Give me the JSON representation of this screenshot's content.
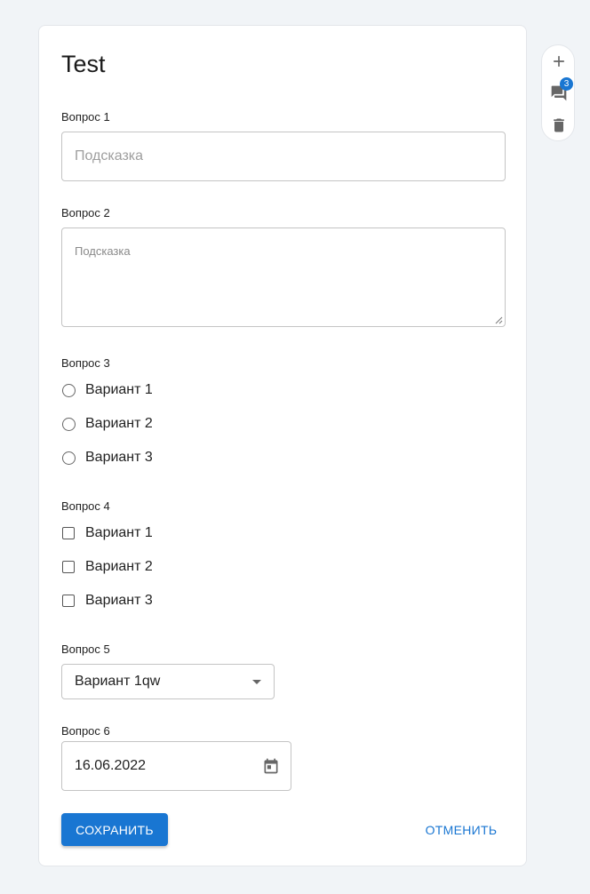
{
  "form": {
    "title": "Test",
    "q1": {
      "label": "Вопрос 1",
      "placeholder": "Подсказка"
    },
    "q2": {
      "label": "Вопрос 2",
      "placeholder": "Подсказка"
    },
    "q3": {
      "label": "Вопрос 3",
      "options": [
        "Вариант 1",
        "Вариант 2",
        "Вариант 3"
      ]
    },
    "q4": {
      "label": "Вопрос 4",
      "options": [
        "Вариант 1",
        "Вариант 2",
        "Вариант 3"
      ]
    },
    "q5": {
      "label": "Вопрос 5",
      "selected": "Вариант 1qw"
    },
    "q6": {
      "label": "Вопрос 6",
      "value": "16.06.2022"
    },
    "save_label": "СОХРАНИТЬ",
    "cancel_label": "ОТМЕНИТЬ"
  },
  "toolbar": {
    "add_icon": "plus-icon",
    "comments_icon": "comment-icon",
    "comments_count": "3",
    "delete_icon": "trash-icon"
  },
  "colors": {
    "accent": "#1976d2",
    "background": "#f1f4f7"
  }
}
